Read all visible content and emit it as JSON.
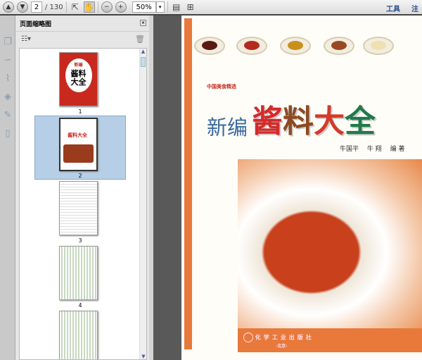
{
  "toolbar": {
    "page_current": "2",
    "page_total": "/ 130",
    "zoom": "50%",
    "tools": "工具",
    "comment": "注释"
  },
  "panel": {
    "title": "页面缩略图",
    "thumbnails": [
      {
        "label": "1",
        "title": "酱料",
        "title2": "大全",
        "sub": "新编"
      },
      {
        "label": "2",
        "title": "酱料大全"
      },
      {
        "label": "3"
      },
      {
        "label": "4"
      }
    ],
    "selected": "2"
  },
  "document": {
    "series": "中国美食精选",
    "title_prefix": "新编",
    "title_chars": [
      "酱",
      "料",
      "大",
      "全"
    ],
    "authors": "牛国平　 牛 翔　 编 著",
    "publisher": "化学工业出版社",
    "city": "·北京·"
  },
  "colors": {
    "accent": "#2a4f8a",
    "selection": "#b6cfe6",
    "orange": "#e8793a"
  }
}
